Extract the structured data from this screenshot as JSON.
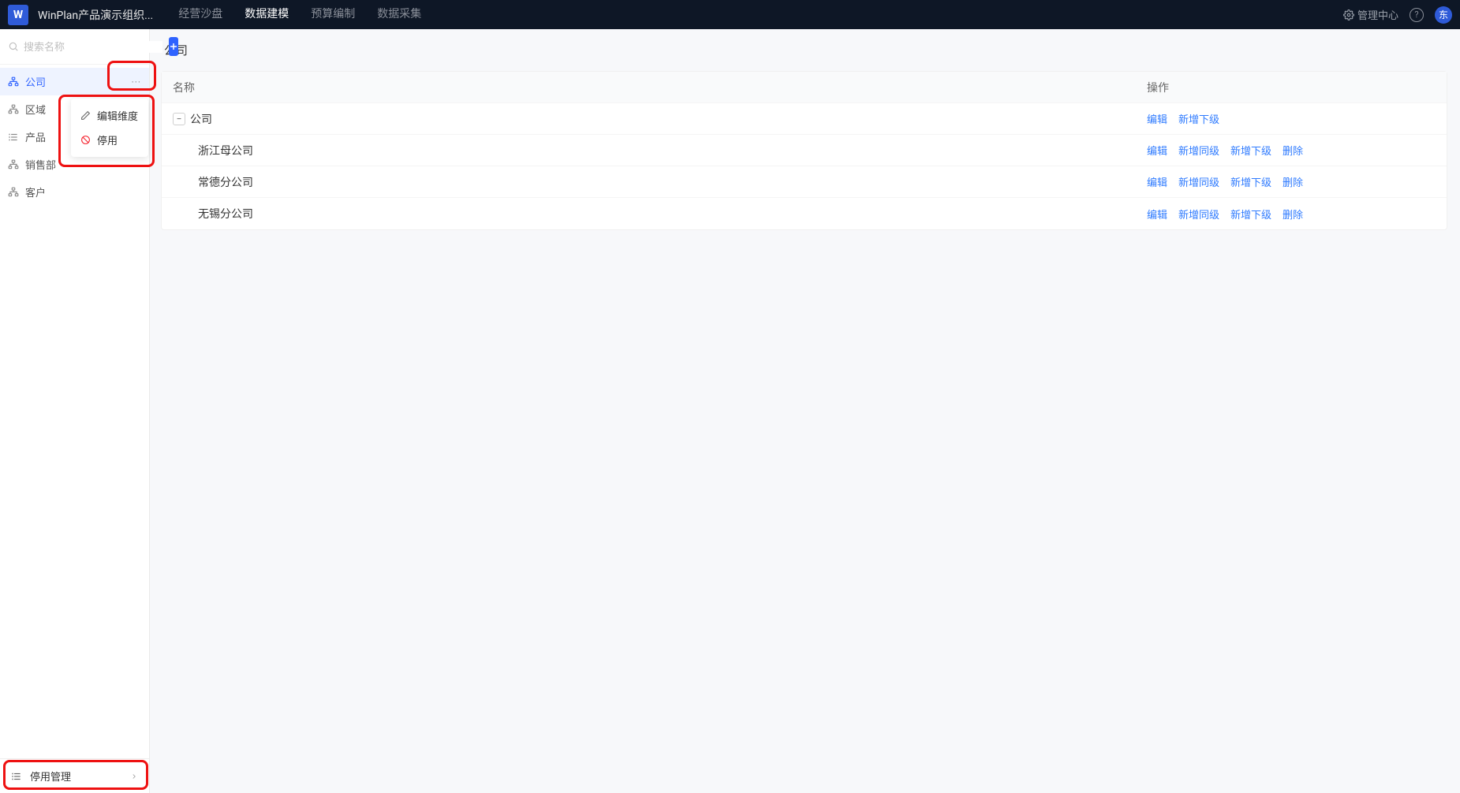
{
  "header": {
    "logo_letter": "W",
    "app_title": "WinPlan产品演示组织...",
    "tabs": [
      {
        "label": "经营沙盘",
        "active": false
      },
      {
        "label": "数据建模",
        "active": true
      },
      {
        "label": "预算编制",
        "active": false
      },
      {
        "label": "数据采集",
        "active": false
      }
    ],
    "mgmt_center": "管理中心",
    "avatar_text": "东"
  },
  "sidebar": {
    "search_placeholder": "搜索名称",
    "items": [
      {
        "label": "公司",
        "active": true,
        "icon": "org"
      },
      {
        "label": "区域",
        "active": false,
        "icon": "org"
      },
      {
        "label": "产品",
        "active": false,
        "icon": "list"
      },
      {
        "label": "销售部",
        "active": false,
        "icon": "org"
      },
      {
        "label": "客户",
        "active": false,
        "icon": "org"
      }
    ],
    "popover": {
      "edit": "编辑维度",
      "disable": "停用"
    },
    "footer": "停用管理"
  },
  "main": {
    "title": "公司",
    "columns": {
      "name": "名称",
      "ops": "操作"
    },
    "actions": {
      "edit": "编辑",
      "add_peer": "新增同级",
      "add_child": "新增下级",
      "delete": "删除"
    },
    "rows": [
      {
        "name": "公司",
        "level": 0,
        "has_toggle": true,
        "ops": [
          "edit",
          "add_child"
        ]
      },
      {
        "name": "浙江母公司",
        "level": 1,
        "has_toggle": false,
        "ops": [
          "edit",
          "add_peer",
          "add_child",
          "delete"
        ]
      },
      {
        "name": "常德分公司",
        "level": 1,
        "has_toggle": false,
        "ops": [
          "edit",
          "add_peer",
          "add_child",
          "delete"
        ]
      },
      {
        "name": "无锡分公司",
        "level": 1,
        "has_toggle": false,
        "ops": [
          "edit",
          "add_peer",
          "add_child",
          "delete"
        ]
      }
    ]
  }
}
